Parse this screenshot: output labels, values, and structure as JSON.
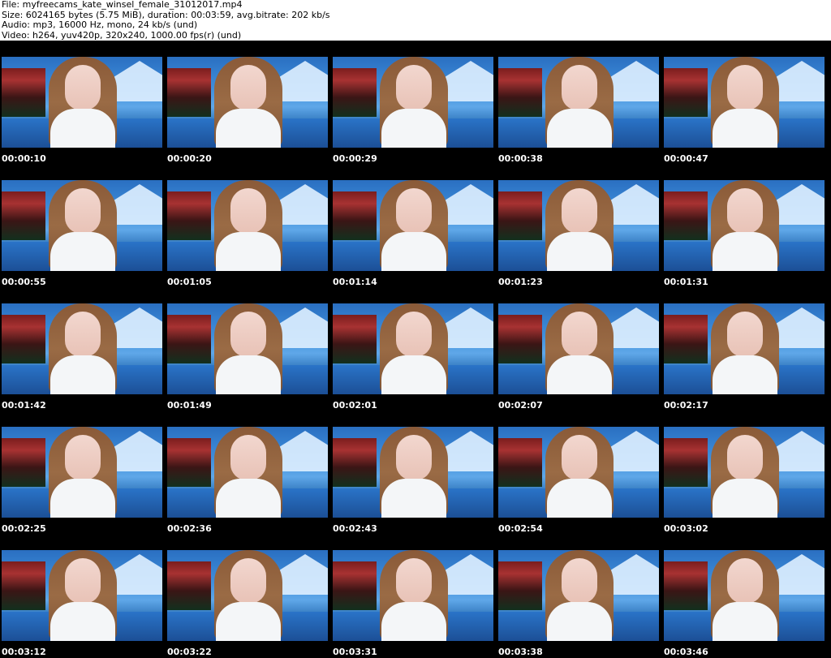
{
  "header": {
    "file": "File: myfreecams_kate_winsel_female_31012017.mp4",
    "size": "Size: 6024165 bytes (5.75 MiB), duration: 00:03:59, avg.bitrate: 202 kb/s",
    "audio": "Audio: mp3, 16000 Hz, mono, 24 kb/s (und)",
    "video": "Video: h264, yuv420p, 320x240, 1000.00 fps(r) (und)"
  },
  "thumbnails": [
    {
      "timestamp": "00:00:10"
    },
    {
      "timestamp": "00:00:20"
    },
    {
      "timestamp": "00:00:29"
    },
    {
      "timestamp": "00:00:38"
    },
    {
      "timestamp": "00:00:47"
    },
    {
      "timestamp": "00:00:55"
    },
    {
      "timestamp": "00:01:05"
    },
    {
      "timestamp": "00:01:14"
    },
    {
      "timestamp": "00:01:23"
    },
    {
      "timestamp": "00:01:31"
    },
    {
      "timestamp": "00:01:42"
    },
    {
      "timestamp": "00:01:49"
    },
    {
      "timestamp": "00:02:01"
    },
    {
      "timestamp": "00:02:07"
    },
    {
      "timestamp": "00:02:17"
    },
    {
      "timestamp": "00:02:25"
    },
    {
      "timestamp": "00:02:36"
    },
    {
      "timestamp": "00:02:43"
    },
    {
      "timestamp": "00:02:54"
    },
    {
      "timestamp": "00:03:02"
    },
    {
      "timestamp": "00:03:12"
    },
    {
      "timestamp": "00:03:22"
    },
    {
      "timestamp": "00:03:31"
    },
    {
      "timestamp": "00:03:38"
    },
    {
      "timestamp": "00:03:46"
    }
  ],
  "colors": {
    "background": "#000000",
    "header_bg": "#ffffff",
    "timestamp_text": "#ffffff"
  }
}
